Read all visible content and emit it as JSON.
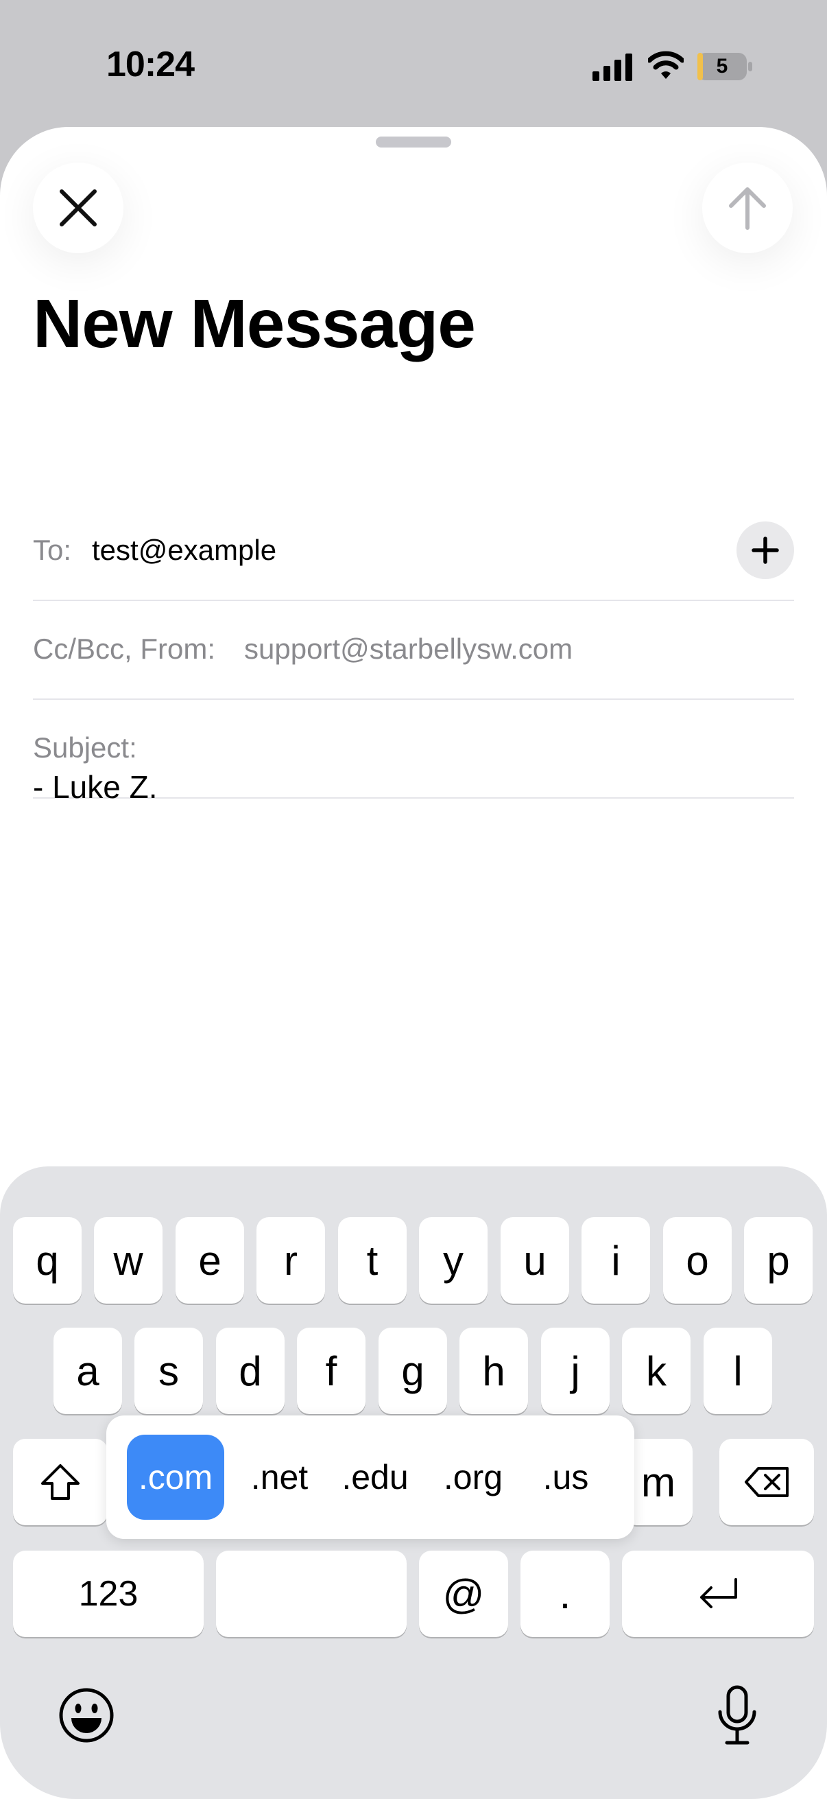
{
  "status_bar": {
    "time": "10:24",
    "battery_level": "5",
    "icons": [
      "cellular-signal-icon",
      "wifi-icon",
      "battery-icon"
    ]
  },
  "sheet": {
    "title": "New Message",
    "close_icon": "close-icon",
    "send_icon": "send-arrow-up-icon"
  },
  "fields": {
    "to_label": "To:",
    "to_value": "test@example",
    "add_contact_icon": "plus-icon",
    "cc_label": "Cc/Bcc, From:",
    "cc_value": "support@starbellysw.com",
    "subject_label": "Subject:",
    "subject_value": ""
  },
  "body": {
    "signature": "- Luke Z."
  },
  "keyboard": {
    "row1": [
      "q",
      "w",
      "e",
      "r",
      "t",
      "y",
      "u",
      "i",
      "o",
      "p"
    ],
    "row2": [
      "a",
      "s",
      "d",
      "f",
      "g",
      "h",
      "j",
      "k",
      "l"
    ],
    "row3_visible": [
      "m"
    ],
    "numbers_label": "123",
    "at_label": "@",
    "dot_label": ".",
    "domain_suggestions": [
      ".com",
      ".net",
      ".edu",
      ".org",
      ".us"
    ],
    "selected_suggestion": ".com",
    "icons": [
      "shift-icon",
      "delete-icon",
      "return-icon",
      "emoji-icon",
      "microphone-icon"
    ],
    "colors": {
      "accent": "#3d8af7",
      "background": "#e2e3e6"
    }
  }
}
